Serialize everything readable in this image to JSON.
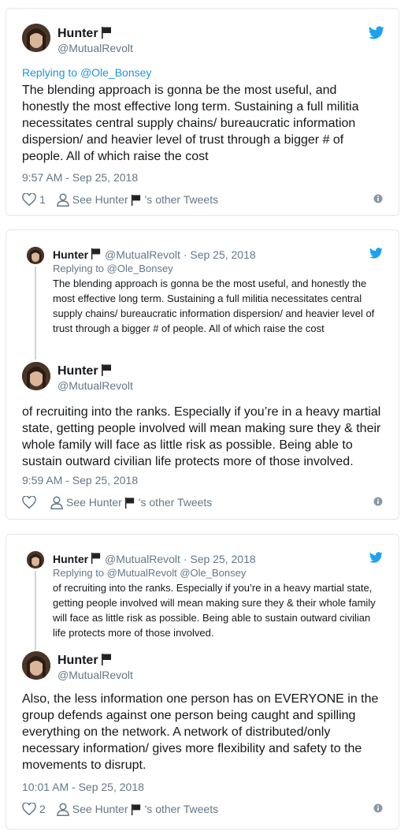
{
  "colors": {
    "link": "#1b95e0",
    "muted": "#657786",
    "text": "#14171a",
    "border": "#e1e8ed",
    "twitter_blue": "#1da1f2"
  },
  "tweet1": {
    "name": "Hunter",
    "handle": "@MutualRevolt",
    "replying_prefix": "Replying to ",
    "replying_to": "@Ole_Bonsey",
    "text": "The blending approach is gonna be the most useful, and honestly the most effective long term. Sustaining a full militia necessitates central supply chains/ bureaucratic information dispersion/ and heavier level of trust through a bigger # of people. All of which raise the cost",
    "timestamp": "9:57 AM - Sep 25, 2018",
    "likes": "1",
    "see_other_prefix": "See Hunter",
    "see_other_suffix": "'s other Tweets"
  },
  "tweet2": {
    "quoted": {
      "name": "Hunter",
      "meta": "@MutualRevolt · Sep 25, 2018",
      "replying": "Replying to @Ole_Bonsey",
      "text": "The blending approach is gonna be the most useful, and honestly the most effective long term. Sustaining a full militia necessitates central supply chains/ bureaucratic information dispersion/ and heavier level of trust through a bigger # of people. All of which raise the cost"
    },
    "name": "Hunter",
    "handle": "@MutualRevolt",
    "text": "of recruiting into the ranks. Especially if you’re in a heavy martial state, getting people involved will mean making sure they & their whole family will face as little risk as possible. Being able to sustain outward civilian life protects more of those involved.",
    "timestamp": "9:59 AM - Sep 25, 2018",
    "see_other_prefix": "See Hunter",
    "see_other_suffix": "'s other Tweets"
  },
  "tweet3": {
    "quoted": {
      "name": "Hunter",
      "meta": "@MutualRevolt · Sep 25, 2018",
      "replying": "Replying to @MutualRevolt @Ole_Bonsey",
      "text": "of recruiting into the ranks. Especially if you’re in a heavy martial state, getting people involved will mean making sure they & their whole family will face as little risk as possible. Being able to sustain outward civilian life protects more of those involved."
    },
    "name": "Hunter",
    "handle": "@MutualRevolt",
    "text": "Also, the less information one person has on EVERYONE in the group defends against one person being caught and spilling everything on the network. A network of distributed/only necessary information/ gives more flexibility and safety to the movements to disrupt.",
    "timestamp": "10:01 AM - Sep 25, 2018",
    "likes": "2",
    "see_other_prefix": "See Hunter",
    "see_other_suffix": "'s other Tweets"
  }
}
